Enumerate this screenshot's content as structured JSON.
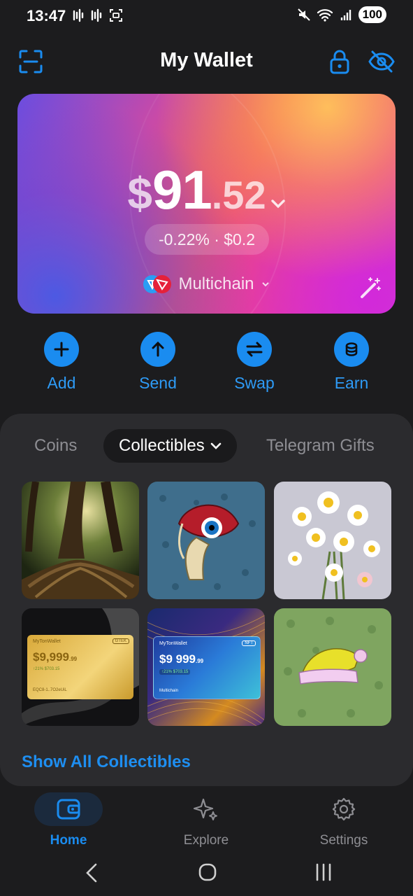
{
  "status": {
    "time": "13:47",
    "battery": "100"
  },
  "header": {
    "title": "My Wallet"
  },
  "balance": {
    "currency": "$",
    "integer": "91",
    "decimal": ".52",
    "change": "-0.22% · $0.2",
    "chain_label": "Multichain"
  },
  "actions": [
    {
      "label": "Add",
      "icon": "plus-icon"
    },
    {
      "label": "Send",
      "icon": "arrow-up-icon"
    },
    {
      "label": "Swap",
      "icon": "swap-icon"
    },
    {
      "label": "Earn",
      "icon": "stack-icon"
    }
  ],
  "tabs": {
    "coins": "Coins",
    "collectibles": "Collectibles",
    "gifts": "Telegram Gifts"
  },
  "collectibles": {
    "card_a": {
      "brand": "MyTonWallet",
      "tag": "GTEK",
      "amount": "$9,999",
      "cents": ".99",
      "delta": "↑21%  $703.15",
      "addr": "EQC8-1..7O2eUiL"
    },
    "card_b": {
      "brand": "MyTonWallet",
      "tag": "NFT",
      "amount": "$9 999",
      "cents": ".99",
      "delta": "↑21%  $703.15",
      "chain": "Multichain"
    }
  },
  "show_all": "Show All Collectibles",
  "nav": [
    {
      "label": "Home",
      "icon": "wallet-icon",
      "active": true
    },
    {
      "label": "Explore",
      "icon": "sparkle-icon",
      "active": false
    },
    {
      "label": "Settings",
      "icon": "gear-icon",
      "active": false
    }
  ],
  "colors": {
    "accent": "#1a8cf0",
    "background": "#1c1c1e",
    "panel": "#2b2b2e"
  }
}
